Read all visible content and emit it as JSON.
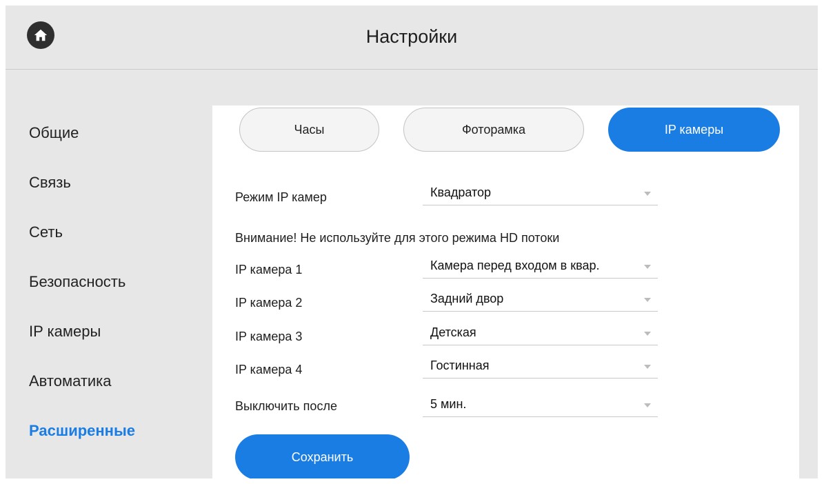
{
  "header": {
    "title": "Настройки",
    "home_icon": "home-icon"
  },
  "sidebar": {
    "items": [
      {
        "label": "Общие"
      },
      {
        "label": "Связь"
      },
      {
        "label": "Сеть"
      },
      {
        "label": "Безопасность"
      },
      {
        "label": "IP камеры"
      },
      {
        "label": "Автоматика"
      },
      {
        "label": "Расширенные",
        "active": true
      }
    ]
  },
  "tabs": [
    {
      "label": "Часы"
    },
    {
      "label": "Фоторамка"
    },
    {
      "label": "IP камеры",
      "active": true
    }
  ],
  "form": {
    "mode": {
      "label": "Режим IP камер",
      "value": "Квадратор"
    },
    "warning": "Внимание! Не используйте для этого режима HD потоки",
    "cameras": [
      {
        "label": "IP камера 1",
        "value": "Камера перед входом в квар."
      },
      {
        "label": "IP камера 2",
        "value": "Задний двор"
      },
      {
        "label": "IP камера 3",
        "value": "Детская"
      },
      {
        "label": "IP камера 4",
        "value": "Гостинная"
      }
    ],
    "off_after": {
      "label": "Выключить после",
      "value": "5 мин."
    },
    "save_label": "Сохранить"
  },
  "colors": {
    "accent": "#1a7de3",
    "background": "#e7e7e7",
    "panel": "#ffffff"
  }
}
